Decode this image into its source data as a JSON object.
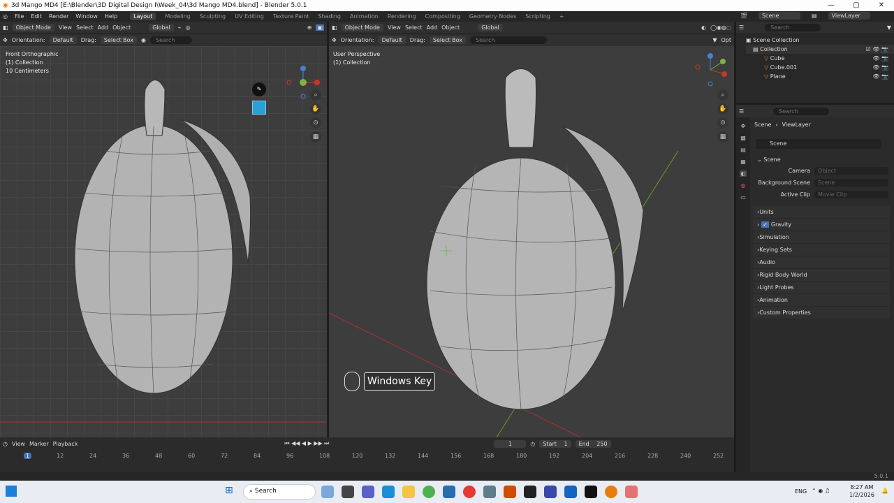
{
  "titlebar": {
    "title": "3d Mango MD4 [E:\\Blender\\3D Digital Design I\\Week_04\\3d Mango MD4.blend] - Blender 5.0.1",
    "min": "—",
    "max": "▢",
    "close": "✕"
  },
  "menu": {
    "file": "File",
    "edit": "Edit",
    "render": "Render",
    "window": "Window",
    "help": "Help"
  },
  "workspaces": [
    "Layout",
    "Modeling",
    "Sculpting",
    "UV Editing",
    "Texture Paint",
    "Shading",
    "Animation",
    "Rendering",
    "Compositing",
    "Geometry Nodes",
    "Scripting",
    "+"
  ],
  "scene_selector": {
    "scene": "Scene",
    "view_layer": "ViewLayer"
  },
  "viewport_left": {
    "mode": "Object Mode",
    "view": "View",
    "select": "Select",
    "add": "Add",
    "object": "Object",
    "transform": "Global",
    "orientation_label": "Orientation:",
    "orientation_value": "Default",
    "drag_label": "Drag:",
    "drag_value": "Select Box",
    "search_placeholder": "Search",
    "view_name": "Front Orthographic",
    "collection": "(1) Collection",
    "scale": "10 Centimeters"
  },
  "viewport_right": {
    "mode": "Object Mode",
    "view": "View",
    "select": "Select",
    "add": "Add",
    "object": "Object",
    "transform": "Global",
    "orientation_label": "Orientation:",
    "orientation_value": "Default",
    "drag_label": "Drag:",
    "drag_value": "Select Box",
    "search_placeholder": "Search",
    "view_name": "User Perspective",
    "collection": "(1) Collection",
    "options": "Opt"
  },
  "keycast": {
    "text": "Windows Key"
  },
  "gizmo": {
    "x": "X",
    "y": "Y",
    "z": "Z"
  },
  "outliner": {
    "search_placeholder": "Search",
    "root": "Scene Collection",
    "collection": "Collection",
    "items": [
      "Cube",
      "Cube.001",
      "Plane"
    ]
  },
  "properties": {
    "search_placeholder": "Search",
    "breadcrumb_scene": "Scene",
    "breadcrumb_layer": "ViewLayer",
    "datablock": "Scene",
    "panel_title": "Scene",
    "camera_label": "Camera",
    "camera_value": "Object",
    "bg_label": "Background Scene",
    "bg_value": "Scene",
    "clip_label": "Active Clip",
    "clip_value": "Movie Clip",
    "panels": [
      "Units",
      "Gravity",
      "Simulation",
      "Keying Sets",
      "Audio",
      "Rigid Body World",
      "Light Probes",
      "Animation",
      "Custom Properties"
    ]
  },
  "timeline": {
    "view": "View",
    "marker": "Marker",
    "playback": "Playback",
    "current_frame": "1",
    "start_label": "Start",
    "start": "1",
    "end_label": "End",
    "end": "250",
    "ticks": [
      "1",
      "12",
      "24",
      "36",
      "48",
      "60",
      "72",
      "84",
      "96",
      "108",
      "120",
      "132",
      "144",
      "156",
      "168",
      "180",
      "192",
      "204",
      "216",
      "228",
      "240",
      "252"
    ]
  },
  "status": {
    "version": "5.0.1"
  },
  "taskbar": {
    "search": "Search",
    "lang": "ENG",
    "time": "8:27 AM",
    "date": "1/2/2026"
  },
  "colors": {
    "accent": "#4772b3",
    "active_orange": "#e87d0d",
    "axis_x": "#c0392b",
    "axis_y": "#7cb342"
  }
}
